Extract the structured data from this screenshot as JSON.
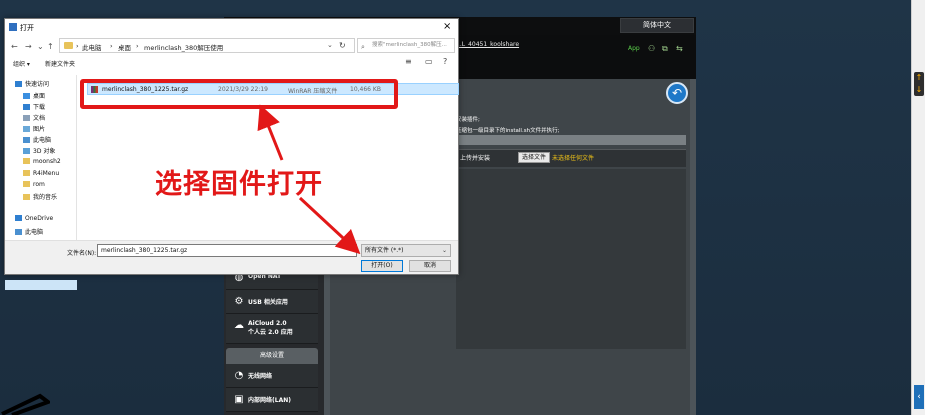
{
  "router": {
    "lang": "简体中文",
    "user": "...L_40451_koolshare",
    "app": "App",
    "desc1": "安装插件;",
    "desc2": "压缩包一级目录下的install.sh文件并执行;",
    "upload_label": "上传并安装",
    "choose_btn": "选择文件",
    "no_file": "未选择任何文件",
    "menu": [
      {
        "icon": "globe-icon",
        "label": "Open NAT"
      },
      {
        "icon": "usb-icon",
        "label": "USB 相关应用"
      },
      {
        "icon": "cloud-icon",
        "label": "AiCloud 2.0",
        "label2": "个人云 2.0 应用"
      }
    ],
    "advanced_header": "高级设置",
    "menu2": [
      {
        "icon": "wifi-icon",
        "label": "无线网络"
      },
      {
        "icon": "lan-icon",
        "label": "内部网络(LAN)"
      }
    ]
  },
  "dialog": {
    "title": "打开",
    "path": [
      "此电脑",
      "桌面",
      "merlinclash_380解压使用"
    ],
    "search_placeholder": "搜索\"merlinclash_380解压...",
    "organize": "组织 ▾",
    "new_folder": "新建文件夹",
    "sidebar": [
      {
        "label": "快速访问",
        "icon": "star-icon",
        "color": "#2f7fd0",
        "pinned": false
      },
      {
        "label": "桌面",
        "icon": "desktop-icon",
        "color": "#3b8fe0",
        "pinned": true
      },
      {
        "label": "下载",
        "icon": "download-icon",
        "color": "#2f7fd0",
        "pinned": true
      },
      {
        "label": "文档",
        "icon": "document-icon",
        "color": "#8aa0b8",
        "pinned": true
      },
      {
        "label": "图片",
        "icon": "picture-icon",
        "color": "#6aa8d8",
        "pinned": true
      },
      {
        "label": "此电脑",
        "icon": "computer-icon",
        "color": "#4a90d0",
        "pinned": true
      },
      {
        "label": "3D 对象",
        "icon": "cube-icon",
        "color": "#5aa0d8",
        "pinned": false
      },
      {
        "label": "moonsh2",
        "icon": "folder-icon",
        "color": "#e8c35a",
        "pinned": false
      },
      {
        "label": "R4iMenu",
        "icon": "folder-icon",
        "color": "#e8c35a",
        "pinned": false
      },
      {
        "label": "rom",
        "icon": "folder-icon",
        "color": "#e8c35a",
        "pinned": false
      },
      {
        "label": "我的音乐",
        "icon": "folder-icon",
        "color": "#e8c35a",
        "pinned": false
      },
      {
        "label": "OneDrive",
        "icon": "cloud-icon",
        "color": "#2f7fd0",
        "pinned": false
      },
      {
        "label": "此电脑",
        "icon": "computer-icon",
        "color": "#4a90d0",
        "pinned": false
      }
    ],
    "file": {
      "name": "merlinclash_380_1225.tar.gz",
      "date": "2021/3/29 22:19",
      "type": "WinRAR 压缩文件",
      "size": "10,466 KB"
    },
    "filename_label": "文件名(N):",
    "filename_value": "merlinclash_380_1225.tar.gz",
    "filetype": "所有文件 (*.*)",
    "open_btn": "打开(O)",
    "cancel_btn": "取消"
  },
  "annotation": "选择固件打开",
  "colors": {
    "annotation": "#e21818",
    "selection": "#cce8ff",
    "router_bg": "#27292c"
  }
}
